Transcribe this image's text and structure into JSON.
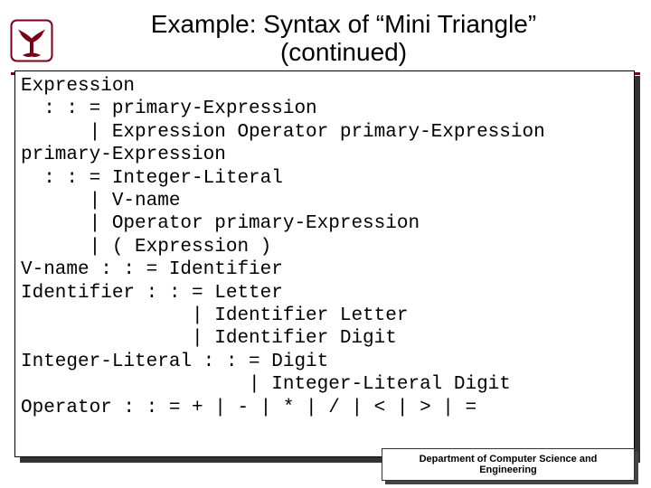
{
  "title": {
    "line1": "Example: Syntax of “Mini Triangle”",
    "line2": "(continued)"
  },
  "grammar_lines": [
    "Expression",
    "  : : = primary-Expression",
    "      | Expression Operator primary-Expression",
    "primary-Expression",
    "  : : = Integer-Literal",
    "      | V-name",
    "      | Operator primary-Expression",
    "      | ( Expression )",
    "V-name : : = Identifier",
    "Identifier : : = Letter",
    "               | Identifier Letter",
    "               | Identifier Digit",
    "Integer-Literal : : = Digit",
    "                    | Integer-Literal Digit",
    "Operator : : = + | - | * | / | < | > | ="
  ],
  "footer": {
    "line1": "Department of Computer Science and",
    "line2": "Engineering"
  },
  "logo": {
    "name": "palmetto-logo"
  }
}
